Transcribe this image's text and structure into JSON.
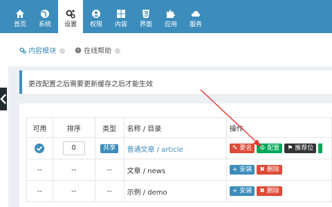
{
  "nav": {
    "items": [
      {
        "label": "首页",
        "icon": "home-icon"
      },
      {
        "label": "系统",
        "icon": "globe-icon"
      },
      {
        "label": "设置",
        "icon": "cogs-icon"
      },
      {
        "label": "权限",
        "icon": "user-icon"
      },
      {
        "label": "内容",
        "icon": "grid-icon"
      },
      {
        "label": "界面",
        "icon": "html5-icon"
      },
      {
        "label": "应用",
        "icon": "puzzle-icon"
      },
      {
        "label": "服务",
        "icon": "cloud-icon"
      }
    ],
    "active_index": 2
  },
  "subtabs": [
    {
      "label": "内容模块",
      "icon": "cogs-icon"
    },
    {
      "label": "在线帮助",
      "icon": "question-icon"
    }
  ],
  "callout": {
    "text": "更改配置之后需要更新缓存之后才能生效"
  },
  "table": {
    "headers": [
      "可用",
      "排序",
      "类型",
      "名称 / 目录",
      "操作"
    ],
    "rows": [
      {
        "enabled": true,
        "order": "0",
        "type": "共享",
        "name": "普通文章 / article",
        "actions": [
          "更名",
          "配置",
          "推荐位"
        ]
      },
      {
        "enabled": false,
        "enabled_text": "--",
        "order": "--",
        "type": "--",
        "name": "文章 / news",
        "actions": [
          "安装",
          "删除"
        ]
      },
      {
        "enabled": false,
        "enabled_text": "--",
        "order": "--",
        "type": "--",
        "name": "示例 / demo",
        "actions": [
          "安装",
          "删除"
        ]
      }
    ]
  },
  "colors": {
    "primary": "#3c8dbc",
    "danger": "#dd4b39",
    "success": "#00a65a",
    "dark": "#333333"
  }
}
